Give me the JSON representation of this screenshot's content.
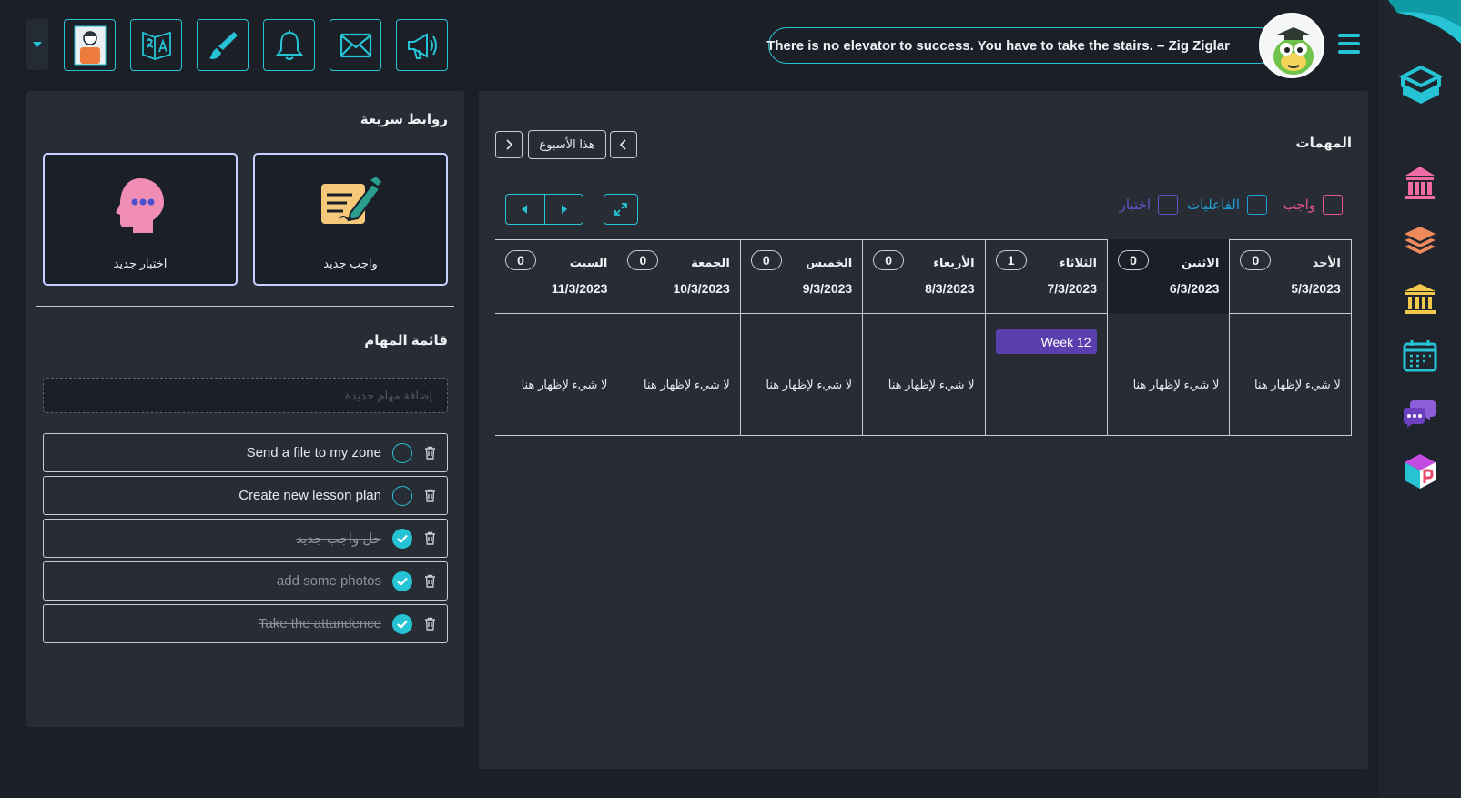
{
  "quote": "There is no elevator to success. You have to take the stairs. – Zig Ziglar",
  "toolbar": {
    "buttons": [
      {
        "icon": "student-profile-icon"
      },
      {
        "icon": "translate-icon"
      },
      {
        "icon": "brush-icon"
      },
      {
        "icon": "bell-icon"
      },
      {
        "icon": "mail-icon"
      },
      {
        "icon": "megaphone-icon"
      }
    ]
  },
  "quick_links": {
    "title": "روابط سريعة",
    "new_assignment_label": "واجب جديد",
    "new_quiz_label": "اختبار جديد"
  },
  "todo": {
    "title": "قائمة المهام",
    "placeholder": "إضافة مهام جديدة",
    "items": [
      {
        "text": "Send a file to my zone",
        "done": false
      },
      {
        "text": "Create new lesson plan",
        "done": false
      },
      {
        "text": "حل واجب جديد",
        "done": true
      },
      {
        "text": "add some photos",
        "done": true
      },
      {
        "text": "Take the attandence",
        "done": true
      }
    ]
  },
  "tasks": {
    "title": "المهمات",
    "this_week_label": "هذا الأسبوع",
    "legend": [
      {
        "label": "واجب",
        "color": "#e8508f"
      },
      {
        "label": "الفاعليات",
        "color": "#1e9fd6"
      },
      {
        "label": "اختبار",
        "color": "#6a4fc7"
      }
    ],
    "days": [
      {
        "name": "الأحد",
        "date": "5/3/2023",
        "count": "0",
        "empty_text": "لا شيء لإظهار هنا"
      },
      {
        "name": "الاثنين",
        "date": "6/3/2023",
        "count": "0",
        "empty_text": "لا شيء لإظهار هنا"
      },
      {
        "name": "الثلاثاء",
        "date": "7/3/2023",
        "count": "1",
        "event": "Week 12"
      },
      {
        "name": "الأربعاء",
        "date": "8/3/2023",
        "count": "0",
        "empty_text": "لا شيء لإظهار هنا"
      },
      {
        "name": "الخميس",
        "date": "9/3/2023",
        "count": "0",
        "empty_text": "لا شيء لإظهار هنا"
      },
      {
        "name": "الجمعة",
        "date": "10/3/2023",
        "count": "0",
        "empty_text": "لا شيء لإظهار هنا"
      },
      {
        "name": "السبت",
        "date": "11/3/2023",
        "count": "0",
        "empty_text": "لا شيء لإظهار هنا"
      }
    ]
  },
  "colors": {
    "accent": "#25c3d4",
    "panel": "#272c35",
    "background": "#1b2028",
    "event": "#5b3fae"
  },
  "rail": {
    "items": [
      "logo-icon",
      "school-icon",
      "layers-icon",
      "institution-icon",
      "calendar-icon",
      "chat-icon",
      "app-icon"
    ]
  }
}
